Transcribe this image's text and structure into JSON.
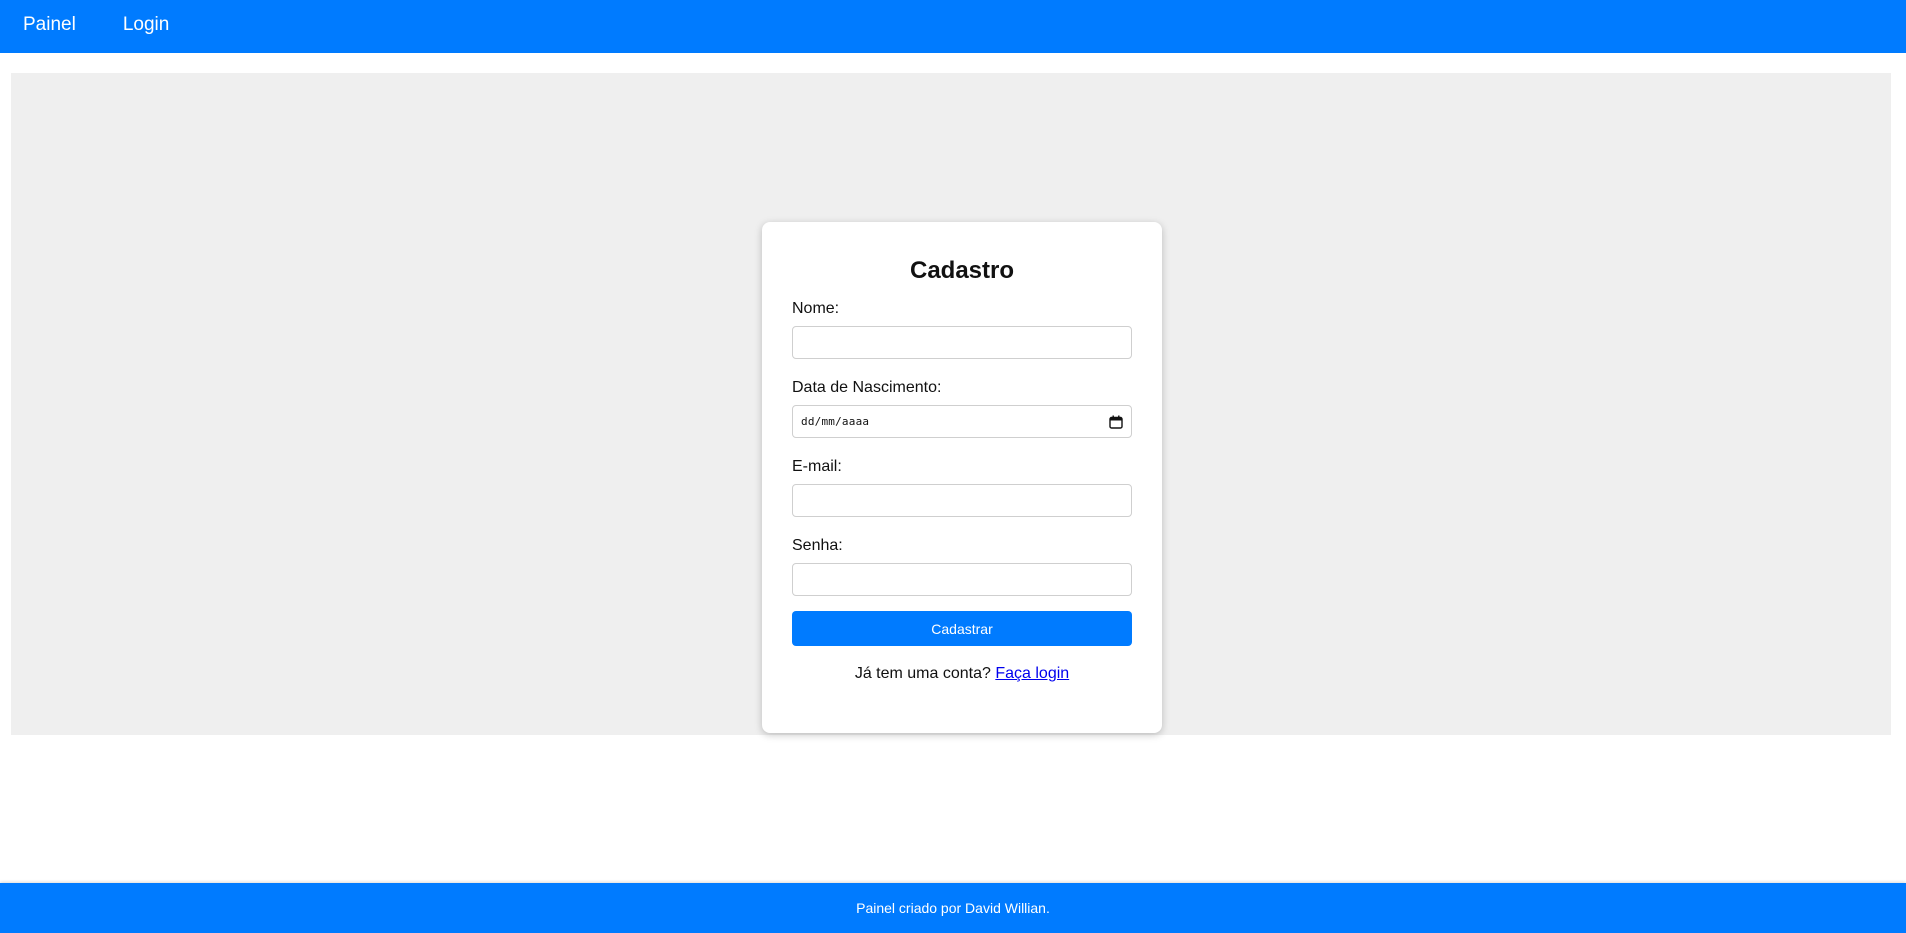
{
  "navbar": {
    "links": [
      {
        "label": "Painel"
      },
      {
        "label": "Login"
      }
    ],
    "background_color": "#007bff"
  },
  "form": {
    "title": "Cadastro",
    "fields": {
      "name": {
        "label": "Nome:",
        "value": "",
        "placeholder": ""
      },
      "birthdate": {
        "label": "Data de Nascimento:",
        "value": "",
        "placeholder": "dd/mm/aaaa"
      },
      "email": {
        "label": "E-mail:",
        "value": "",
        "placeholder": ""
      },
      "password": {
        "label": "Senha:",
        "value": "",
        "placeholder": ""
      }
    },
    "submit_label": "Cadastrar",
    "login_prompt": {
      "text": "Já tem uma conta?",
      "link_label": "Faça login"
    }
  },
  "footer": {
    "text": "Painel criado por David Willian."
  },
  "colors": {
    "accent": "#007bff",
    "main_background": "#efefef",
    "link": "#0000ee"
  },
  "icons": {
    "date_picker": "calendar-icon"
  }
}
